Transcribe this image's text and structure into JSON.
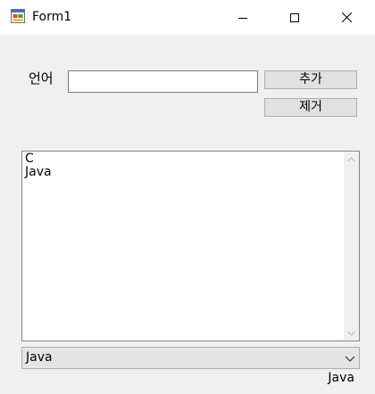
{
  "window": {
    "title": "Form1"
  },
  "form": {
    "label": "언어",
    "input_value": "",
    "add_button": "추가",
    "remove_button": "제거"
  },
  "listbox": {
    "items": [
      "C",
      "Java"
    ]
  },
  "combobox": {
    "selected": "Java"
  },
  "status_label": "Java"
}
